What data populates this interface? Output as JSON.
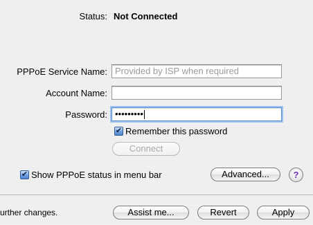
{
  "status": {
    "label": "Status:",
    "value": "Not Connected"
  },
  "pppoe_service": {
    "label": "PPPoE Service Name:",
    "placeholder": "Provided by ISP when required",
    "value": ""
  },
  "account": {
    "label": "Account Name:",
    "value": ""
  },
  "password": {
    "label": "Password:",
    "masked_value": "•••••••••"
  },
  "remember_password": {
    "label": "Remember this password",
    "checked": true,
    "checkmark": "✔"
  },
  "connect_button": {
    "label": "Connect",
    "enabled": false
  },
  "show_status": {
    "label": "Show PPPoE status in menu bar",
    "checked": true,
    "checkmark": "✔"
  },
  "advanced_button": {
    "label": "Advanced..."
  },
  "help_button": {
    "label": "?"
  },
  "footer": {
    "message": "urther changes.",
    "assist_label": "Assist me...",
    "revert_label": "Revert",
    "apply_label": "Apply"
  },
  "colors": {
    "focus_ring": "#9ec1ee",
    "checkbox_blue": "#6fa1e0",
    "help_purple": "#6a2fb5"
  }
}
